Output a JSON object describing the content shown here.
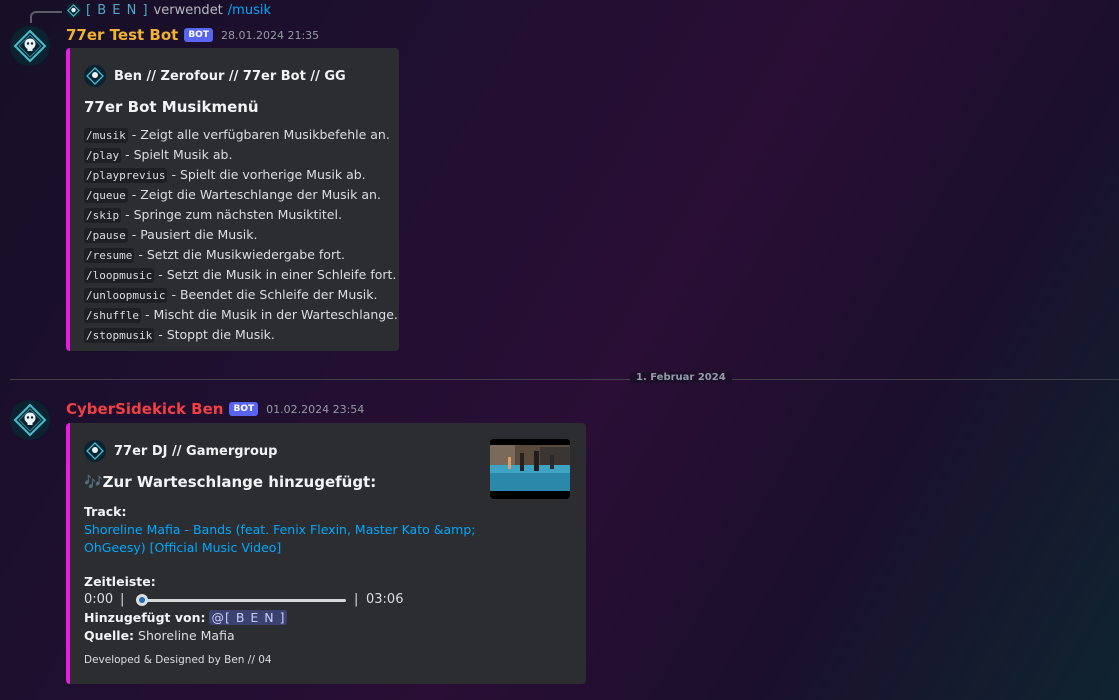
{
  "reply": {
    "name": "[ B E N ]",
    "verb": "verwendet",
    "command": "/musik"
  },
  "message1": {
    "username": "77er Test Bot",
    "username_color": "#f0b232",
    "badge": "BOT",
    "timestamp": "28.01.2024 21:35",
    "embed": {
      "author": "Ben // Zerofour // 77er Bot // GG",
      "title": "77er Bot Musikmenü",
      "commands": [
        {
          "cmd": "/musik",
          "desc": " - Zeigt alle verfügbaren Musikbefehle an."
        },
        {
          "cmd": "/play",
          "desc": " - Spielt Musik ab."
        },
        {
          "cmd": "/playprevius",
          "desc": " - Spielt die vorherige Musik ab."
        },
        {
          "cmd": "/queue",
          "desc": " - Zeigt die Warteschlange der Musik an."
        },
        {
          "cmd": "/skip",
          "desc": " - Springe zum nächsten Musiktitel."
        },
        {
          "cmd": "/pause",
          "desc": " - Pausiert die Musik."
        },
        {
          "cmd": "/resume",
          "desc": " - Setzt die Musikwiedergabe fort."
        },
        {
          "cmd": "/loopmusic",
          "desc": " - Setzt die Musik in einer Schleife fort."
        },
        {
          "cmd": "/unloopmusic",
          "desc": " - Beendet die Schleife der Musik."
        },
        {
          "cmd": "/shuffle",
          "desc": " - Mischt die Musik in der Warteschlange."
        },
        {
          "cmd": "/stopmusik",
          "desc": " - Stoppt die Musik."
        }
      ]
    }
  },
  "divider": {
    "date": "1. Februar 2024"
  },
  "message2": {
    "username": "CyberSidekick Ben",
    "username_color": "#f23f43",
    "badge": "BOT",
    "timestamp": "01.02.2024 23:54",
    "embed": {
      "author": "77er DJ // Gamergroup",
      "title": "🎶Zur Warteschlange hinzugefügt:",
      "track_label": "Track:",
      "track_line1": "Shoreline Mafia - Bands (feat. Fenix Flexin, Master Kato &amp;",
      "track_line2": "OhGeesy) [Official Music Video]",
      "timeline_label": "Zeitleiste:",
      "time_start": "0:00",
      "time_sep": "|",
      "time_end": "03:06",
      "progress": 0.0,
      "added_by_label": "Hinzugefügt von:",
      "added_by": "@[ B E N ]",
      "source_label": "Quelle:",
      "source": "Shoreline Mafia",
      "footer": "Developed & Designed by Ben // 04"
    }
  },
  "colors": {
    "embed_border": "#e91ee3",
    "link": "#00a8fc",
    "bot_badge": "#5865f2"
  }
}
